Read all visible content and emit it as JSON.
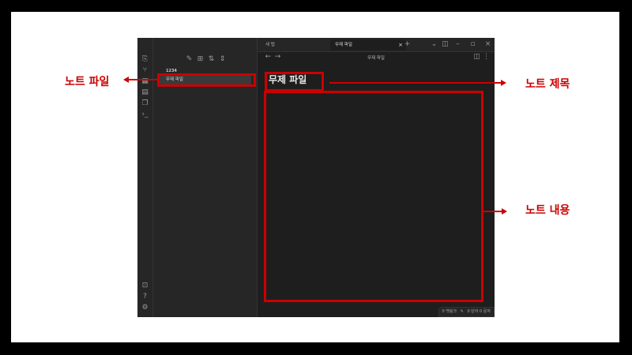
{
  "tabs": [
    {
      "label": "새 탭",
      "active": false
    },
    {
      "label": "무제 파일",
      "active": true
    }
  ],
  "explorer": {
    "folder": "1234",
    "file": "무제 파일"
  },
  "note": {
    "breadcrumb_title": "무제 파일",
    "title": "무제 파일"
  },
  "status": {
    "backlinks": "0 백링크",
    "counts": "0 단어 0 문자"
  },
  "annotations": {
    "note_file": "노트 파일",
    "note_title": "노트 제목",
    "note_content": "노트 내용"
  },
  "colors": {
    "annotation": "#cc0000",
    "app_bg": "#1e1e1e",
    "panel_bg": "#262626"
  }
}
